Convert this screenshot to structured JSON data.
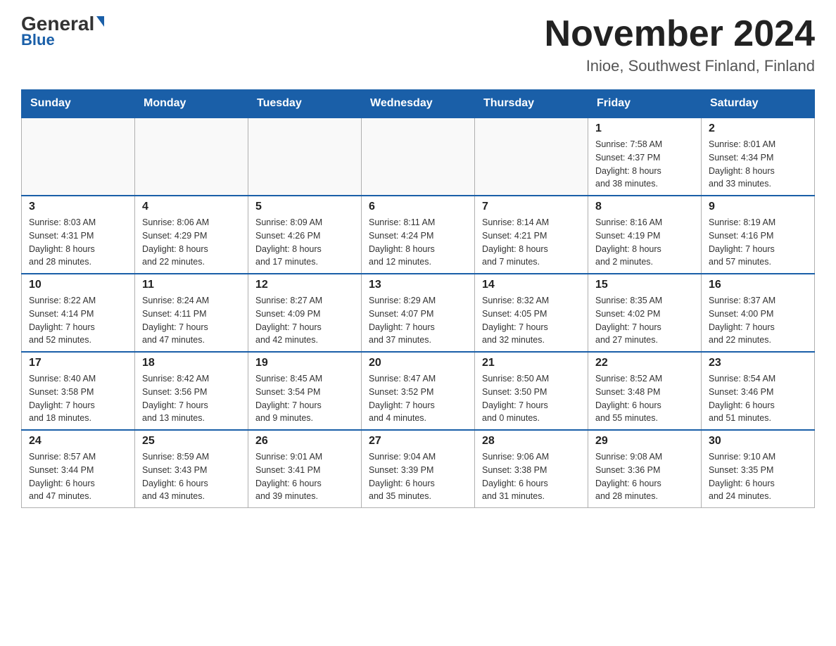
{
  "logo": {
    "general": "General",
    "blue": "Blue"
  },
  "title": "November 2024",
  "subtitle": "Inioe, Southwest Finland, Finland",
  "days_of_week": [
    "Sunday",
    "Monday",
    "Tuesday",
    "Wednesday",
    "Thursday",
    "Friday",
    "Saturday"
  ],
  "weeks": [
    [
      {
        "day": "",
        "info": ""
      },
      {
        "day": "",
        "info": ""
      },
      {
        "day": "",
        "info": ""
      },
      {
        "day": "",
        "info": ""
      },
      {
        "day": "",
        "info": ""
      },
      {
        "day": "1",
        "info": "Sunrise: 7:58 AM\nSunset: 4:37 PM\nDaylight: 8 hours\nand 38 minutes."
      },
      {
        "day": "2",
        "info": "Sunrise: 8:01 AM\nSunset: 4:34 PM\nDaylight: 8 hours\nand 33 minutes."
      }
    ],
    [
      {
        "day": "3",
        "info": "Sunrise: 8:03 AM\nSunset: 4:31 PM\nDaylight: 8 hours\nand 28 minutes."
      },
      {
        "day": "4",
        "info": "Sunrise: 8:06 AM\nSunset: 4:29 PM\nDaylight: 8 hours\nand 22 minutes."
      },
      {
        "day": "5",
        "info": "Sunrise: 8:09 AM\nSunset: 4:26 PM\nDaylight: 8 hours\nand 17 minutes."
      },
      {
        "day": "6",
        "info": "Sunrise: 8:11 AM\nSunset: 4:24 PM\nDaylight: 8 hours\nand 12 minutes."
      },
      {
        "day": "7",
        "info": "Sunrise: 8:14 AM\nSunset: 4:21 PM\nDaylight: 8 hours\nand 7 minutes."
      },
      {
        "day": "8",
        "info": "Sunrise: 8:16 AM\nSunset: 4:19 PM\nDaylight: 8 hours\nand 2 minutes."
      },
      {
        "day": "9",
        "info": "Sunrise: 8:19 AM\nSunset: 4:16 PM\nDaylight: 7 hours\nand 57 minutes."
      }
    ],
    [
      {
        "day": "10",
        "info": "Sunrise: 8:22 AM\nSunset: 4:14 PM\nDaylight: 7 hours\nand 52 minutes."
      },
      {
        "day": "11",
        "info": "Sunrise: 8:24 AM\nSunset: 4:11 PM\nDaylight: 7 hours\nand 47 minutes."
      },
      {
        "day": "12",
        "info": "Sunrise: 8:27 AM\nSunset: 4:09 PM\nDaylight: 7 hours\nand 42 minutes."
      },
      {
        "day": "13",
        "info": "Sunrise: 8:29 AM\nSunset: 4:07 PM\nDaylight: 7 hours\nand 37 minutes."
      },
      {
        "day": "14",
        "info": "Sunrise: 8:32 AM\nSunset: 4:05 PM\nDaylight: 7 hours\nand 32 minutes."
      },
      {
        "day": "15",
        "info": "Sunrise: 8:35 AM\nSunset: 4:02 PM\nDaylight: 7 hours\nand 27 minutes."
      },
      {
        "day": "16",
        "info": "Sunrise: 8:37 AM\nSunset: 4:00 PM\nDaylight: 7 hours\nand 22 minutes."
      }
    ],
    [
      {
        "day": "17",
        "info": "Sunrise: 8:40 AM\nSunset: 3:58 PM\nDaylight: 7 hours\nand 18 minutes."
      },
      {
        "day": "18",
        "info": "Sunrise: 8:42 AM\nSunset: 3:56 PM\nDaylight: 7 hours\nand 13 minutes."
      },
      {
        "day": "19",
        "info": "Sunrise: 8:45 AM\nSunset: 3:54 PM\nDaylight: 7 hours\nand 9 minutes."
      },
      {
        "day": "20",
        "info": "Sunrise: 8:47 AM\nSunset: 3:52 PM\nDaylight: 7 hours\nand 4 minutes."
      },
      {
        "day": "21",
        "info": "Sunrise: 8:50 AM\nSunset: 3:50 PM\nDaylight: 7 hours\nand 0 minutes."
      },
      {
        "day": "22",
        "info": "Sunrise: 8:52 AM\nSunset: 3:48 PM\nDaylight: 6 hours\nand 55 minutes."
      },
      {
        "day": "23",
        "info": "Sunrise: 8:54 AM\nSunset: 3:46 PM\nDaylight: 6 hours\nand 51 minutes."
      }
    ],
    [
      {
        "day": "24",
        "info": "Sunrise: 8:57 AM\nSunset: 3:44 PM\nDaylight: 6 hours\nand 47 minutes."
      },
      {
        "day": "25",
        "info": "Sunrise: 8:59 AM\nSunset: 3:43 PM\nDaylight: 6 hours\nand 43 minutes."
      },
      {
        "day": "26",
        "info": "Sunrise: 9:01 AM\nSunset: 3:41 PM\nDaylight: 6 hours\nand 39 minutes."
      },
      {
        "day": "27",
        "info": "Sunrise: 9:04 AM\nSunset: 3:39 PM\nDaylight: 6 hours\nand 35 minutes."
      },
      {
        "day": "28",
        "info": "Sunrise: 9:06 AM\nSunset: 3:38 PM\nDaylight: 6 hours\nand 31 minutes."
      },
      {
        "day": "29",
        "info": "Sunrise: 9:08 AM\nSunset: 3:36 PM\nDaylight: 6 hours\nand 28 minutes."
      },
      {
        "day": "30",
        "info": "Sunrise: 9:10 AM\nSunset: 3:35 PM\nDaylight: 6 hours\nand 24 minutes."
      }
    ]
  ]
}
